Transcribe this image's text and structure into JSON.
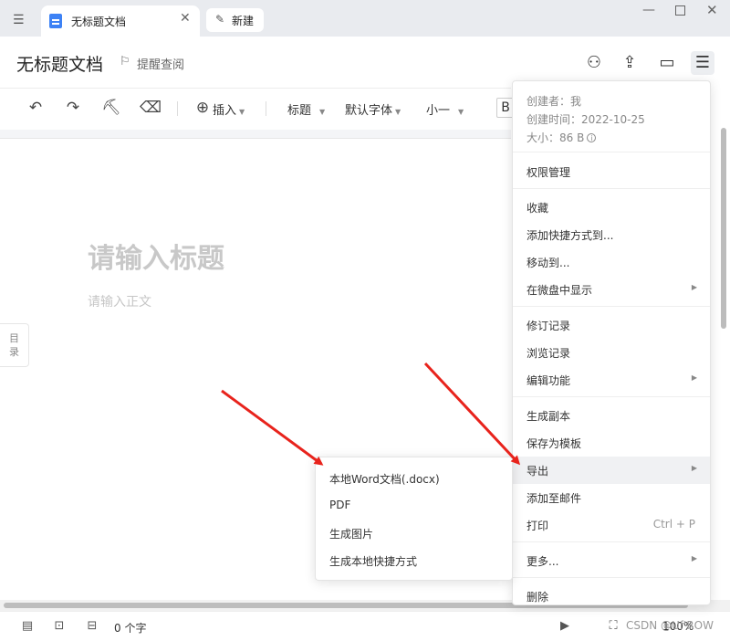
{
  "tabs": {
    "active_title": "无标题文档",
    "new_label": "新建"
  },
  "header": {
    "doc_title": "无标题文档",
    "remind_label": "提醒查阅"
  },
  "toolbar": {
    "insert_label": "插入",
    "heading_label": "标题",
    "font_label": "默认字体",
    "size_label": "小一"
  },
  "editor": {
    "title_placeholder": "请输入标题",
    "body_placeholder": "请输入正文",
    "toc_label_1": "目",
    "toc_label_2": "录"
  },
  "statusbar": {
    "word_count": "0 个字",
    "zoom": "100%",
    "watermark": "CSDN @Uf'ROW"
  },
  "doc_info": {
    "creator": "创建者：我",
    "created": "创建时间：2022-10-25",
    "size": "大小：86 B",
    "info_icon": "i"
  },
  "main_menu": {
    "permissions": "权限管理",
    "favorite": "收藏",
    "add_shortcut": "添加快捷方式到...",
    "move_to": "移动到...",
    "show_in_weipan": "在微盘中显示",
    "revision_history": "修订记录",
    "browse_history": "浏览记录",
    "edit_features": "编辑功能",
    "make_copy": "生成副本",
    "save_template": "保存为模板",
    "export": "导出",
    "add_to_mail": "添加至邮件",
    "print": "打印",
    "print_shortcut": "Ctrl + P",
    "more": "更多...",
    "delete": "删除"
  },
  "export_menu": {
    "word": "本地Word文档(.docx)",
    "pdf": "PDF",
    "image": "生成图片",
    "local_shortcut": "生成本地快捷方式"
  },
  "colors": {
    "accent_blue": "#3d82f5",
    "arrow_red": "#e8231c",
    "tabbar_bg": "#e9ebef"
  }
}
